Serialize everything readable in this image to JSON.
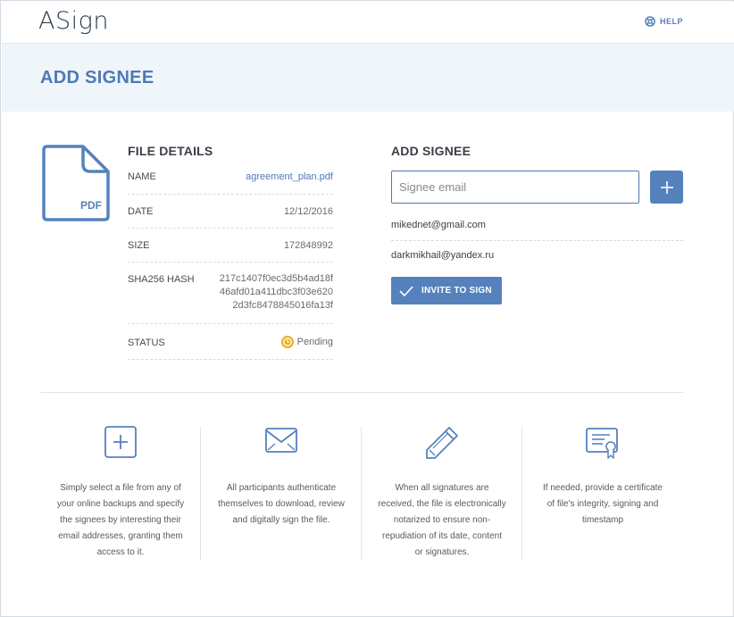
{
  "app": {
    "logo": "ASign",
    "help_label": "HELP"
  },
  "page": {
    "title": "ADD SIGNEE"
  },
  "file": {
    "icon_label": "PDF",
    "section_title": "FILE DETAILS",
    "rows": [
      {
        "key": "NAME",
        "value": "agreement_plan.pdf"
      },
      {
        "key": "DATE",
        "value": "12/12/2016"
      },
      {
        "key": "SIZE",
        "value": "172848992"
      },
      {
        "key": "SHA256 HASH",
        "value_lines": [
          "217c1407f0ec3d5b4ad18f",
          "46afd01a411dbc3f03e620",
          "2d3fc8478845016fa13f"
        ]
      },
      {
        "key": "STATUS",
        "value": "Pending"
      }
    ]
  },
  "signee": {
    "section_title": "ADD SIGNEE",
    "input_placeholder": "Signee email",
    "input_value": "",
    "emails": [
      "mikednet@gmail.com",
      "darkmikhail@yandex.ru"
    ],
    "invite_label": "INVITE TO SIGN"
  },
  "features": [
    {
      "icon": "plus-square-icon",
      "text": "Simply select a file from any of your online backups and specify the signees by interesting their email addresses, granting them access to it."
    },
    {
      "icon": "envelope-icon",
      "text": "All participants authenticate themselves to download, review and digitally sign the file."
    },
    {
      "icon": "pencil-icon",
      "text": "When all signatures are received, the file is electronically notarized to ensure non-repudiation of its date, content or signatures."
    },
    {
      "icon": "certificate-icon",
      "text": "If needed, provide a certificate of file's integrity, signing and timestamp"
    }
  ],
  "colors": {
    "accent": "#4f79b5",
    "button": "#5582bd",
    "pending": "#f0ad1e",
    "band": "#f0f5fa"
  }
}
